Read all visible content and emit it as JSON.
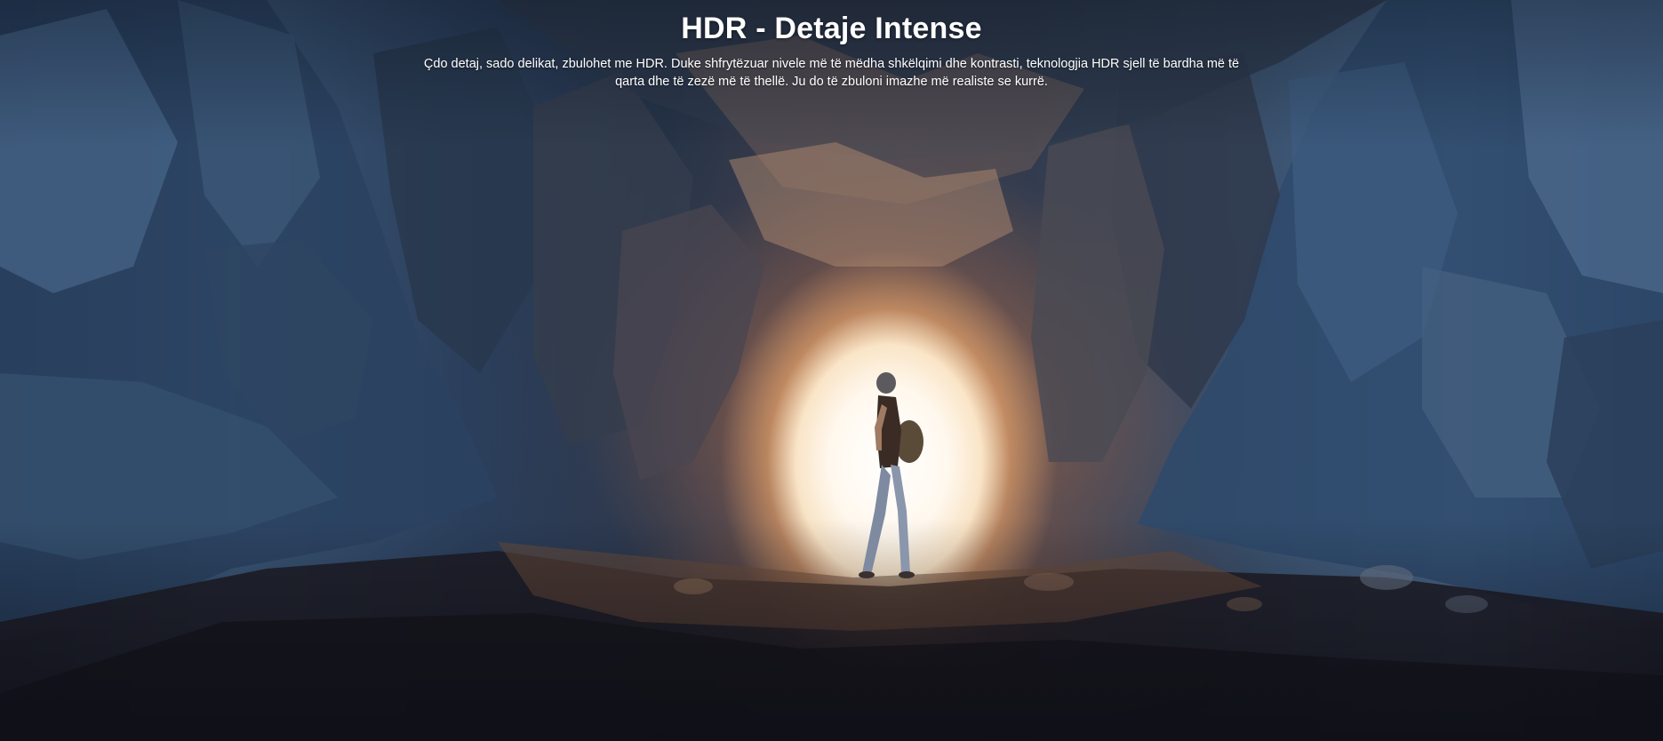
{
  "hero": {
    "title": "HDR - Detaje Intense",
    "description": "Çdo detaj, sado delikat, zbulohet me HDR. Duke shfrytëzuar nivele më të mëdha shkëlqimi dhe kontrasti, teknologjia HDR sjell të bardha më të qarta dhe të zezë më të thellë. Ju do të zbuloni imazhe më realiste se kurrë."
  },
  "colors": {
    "title_text": "#ffffff",
    "rock_blue": "#3a5676",
    "light_core": "#ffffff",
    "warm_glow": "#e0905a"
  }
}
